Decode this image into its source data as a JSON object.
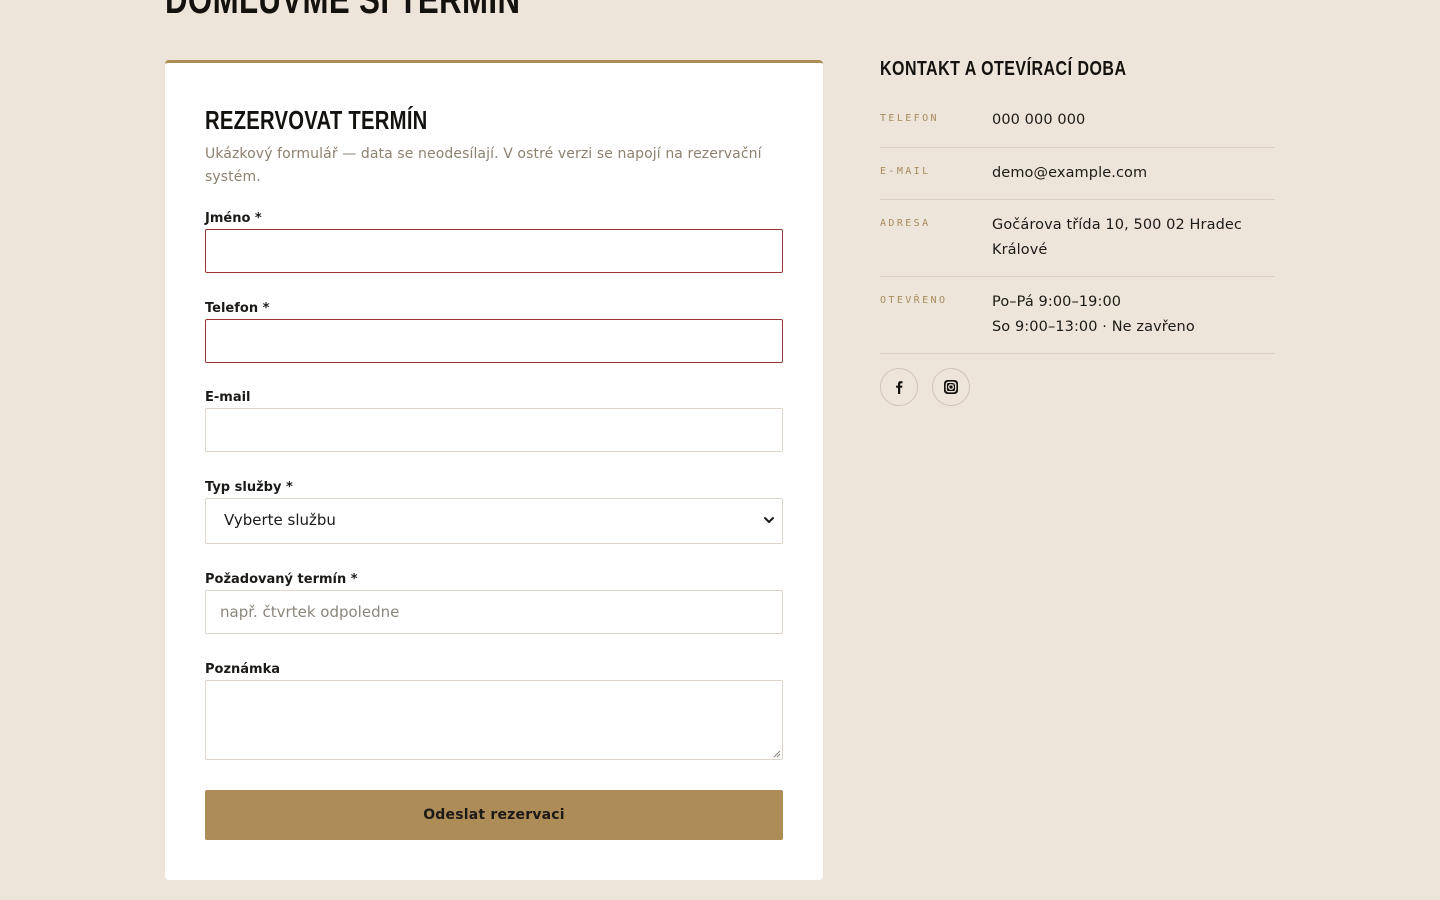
{
  "page": {
    "heading": "DOMLUVME SI TERMÍN"
  },
  "form": {
    "title": "REZERVOVAT TERMÍN",
    "subtitle": "Ukázkový formulář — data se neodesílají. V ostré verzi se napojí na rezervační systém.",
    "fields": {
      "name": {
        "label": "Jméno *",
        "value": ""
      },
      "phone": {
        "label": "Telefon *",
        "value": ""
      },
      "email": {
        "label": "E-mail",
        "value": ""
      },
      "service": {
        "label": "Typ služby *",
        "selected": "Vyberte službu"
      },
      "term": {
        "label": "Požadovaný termín *",
        "value": "",
        "placeholder": "např. čtvrtek odpoledne"
      },
      "note": {
        "label": "Poznámka",
        "value": ""
      }
    },
    "submit_label": "Odeslat rezervaci"
  },
  "contact": {
    "title": "KONTAKT A OTEVÍRACÍ DOBA",
    "rows": [
      {
        "key": "TELEFON",
        "lines": [
          "000 000 000"
        ]
      },
      {
        "key": "E-MAIL",
        "lines": [
          "demo@example.com"
        ]
      },
      {
        "key": "ADRESA",
        "lines": [
          "Gočárova třída 10, 500 02 Hradec",
          "Králové"
        ]
      },
      {
        "key": "OTEVŘENO",
        "lines": [
          "Po–Pá 9:00–19:00",
          "So 9:00–13:00 · Ne zavřeno"
        ]
      }
    ],
    "socials": [
      {
        "icon": "facebook-icon"
      },
      {
        "icon": "instagram-icon"
      }
    ]
  },
  "colors": {
    "background": "#ede5da",
    "accent": "#ae8c57",
    "invalid_border": "#9a3535",
    "muted_text": "#8d8170"
  }
}
